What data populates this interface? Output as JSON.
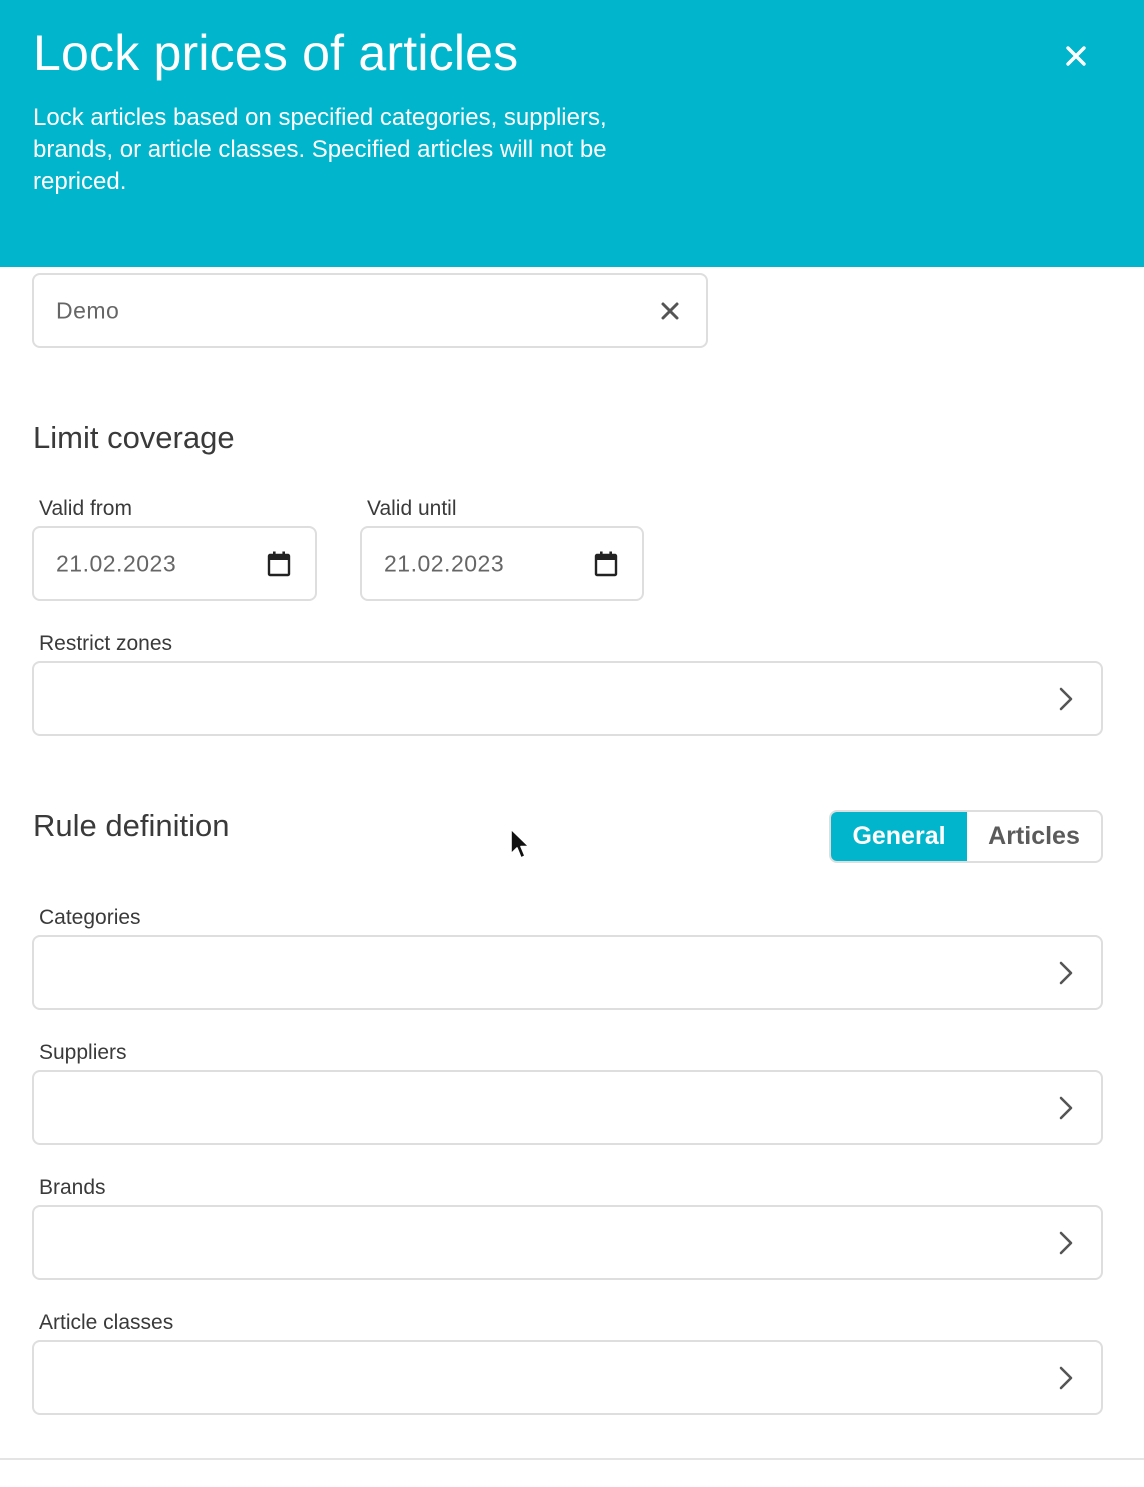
{
  "colors": {
    "accent": "#00b5cc",
    "border": "#dedede",
    "icon": "#555555"
  },
  "header": {
    "title": "Lock prices of articles",
    "description": "Lock articles based on specified categories, suppliers, brands, or article classes. Specified articles will not be repriced.",
    "close_icon": "close-icon"
  },
  "name_field": {
    "value": "Demo",
    "clear_icon": "close-icon"
  },
  "limit_coverage": {
    "title": "Limit coverage",
    "valid_from": {
      "label": "Valid from",
      "value": "21.02.2023",
      "icon": "calendar-icon"
    },
    "valid_until": {
      "label": "Valid until",
      "value": "21.02.2023",
      "icon": "calendar-icon"
    },
    "restrict_zones": {
      "label": "Restrict zones",
      "value": ""
    }
  },
  "rule_definition": {
    "title": "Rule definition",
    "tabs": [
      {
        "label": "General",
        "active": true
      },
      {
        "label": "Articles",
        "active": false
      }
    ],
    "categories": {
      "label": "Categories",
      "value": ""
    },
    "suppliers": {
      "label": "Suppliers",
      "value": ""
    },
    "brands": {
      "label": "Brands",
      "value": ""
    },
    "article_classes": {
      "label": "Article classes",
      "value": ""
    }
  }
}
